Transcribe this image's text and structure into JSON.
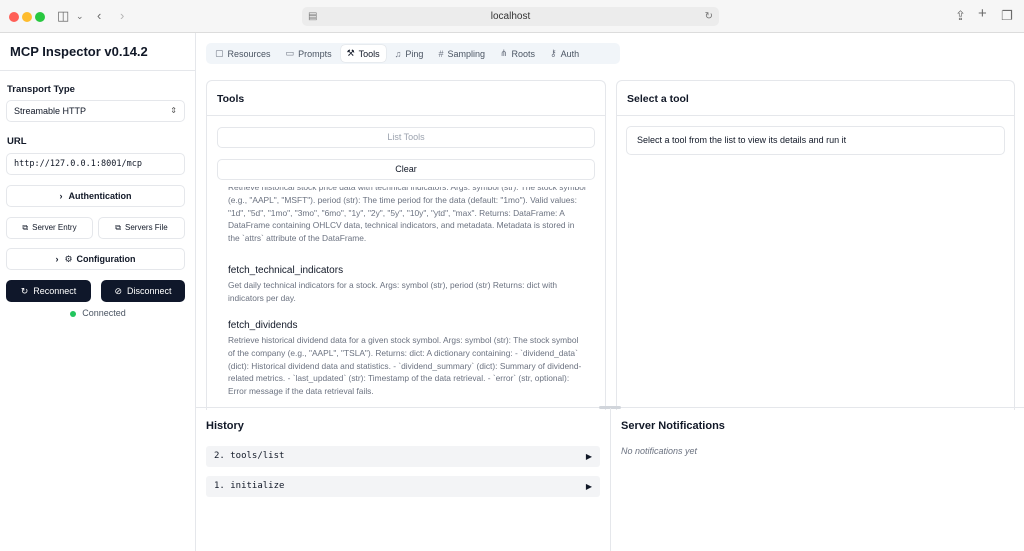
{
  "browser": {
    "url": "localhost"
  },
  "sidebar": {
    "title": "MCP Inspector v0.14.2",
    "transport_label": "Transport Type",
    "transport_value": "Streamable HTTP",
    "url_label": "URL",
    "url_value": "http://127.0.0.1:8001/mcp",
    "authentication_label": "Authentication",
    "server_entry_label": "Server Entry",
    "servers_file_label": "Servers File",
    "configuration_label": "Configuration",
    "reconnect_label": "Reconnect",
    "disconnect_label": "Disconnect",
    "status_text": "Connected",
    "status_color": "#22c55e"
  },
  "tabs": [
    {
      "label": "Resources",
      "icon": "resources-icon",
      "active": false
    },
    {
      "label": "Prompts",
      "icon": "prompts-icon",
      "active": false
    },
    {
      "label": "Tools",
      "icon": "hammer-icon",
      "active": true
    },
    {
      "label": "Ping",
      "icon": "bell-icon",
      "active": false
    },
    {
      "label": "Sampling",
      "icon": "hash-icon",
      "active": false
    },
    {
      "label": "Roots",
      "icon": "network-icon",
      "active": false
    },
    {
      "label": "Auth",
      "icon": "key-icon",
      "active": false
    }
  ],
  "tools_panel": {
    "title": "Tools",
    "list_tools_label": "List Tools",
    "clear_label": "Clear",
    "items": [
      {
        "name": "",
        "description": "Retrieve historical stock price data with technical indicators. Args: symbol (str): The stock symbol (e.g., \"AAPL\", \"MSFT\"). period (str): The time period for the data (default: \"1mo\"). Valid values: \"1d\", \"5d\", \"1mo\", \"3mo\", \"6mo\", \"1y\", \"2y\", \"5y\", \"10y\", \"ytd\", \"max\". Returns: DataFrame: A DataFrame containing OHLCV data, technical indicators, and metadata. Metadata is stored in the `attrs` attribute of the DataFrame."
      },
      {
        "name": "fetch_technical_indicators",
        "description": "Get daily technical indicators for a stock. Args: symbol (str), period (str) Returns: dict with indicators per day."
      },
      {
        "name": "fetch_dividends",
        "description": "Retrieve historical dividend data for a given stock symbol. Args: symbol (str): The stock symbol of the company (e.g., \"AAPL\", \"TSLA\"). Returns: dict: A dictionary containing: - `dividend_data` (dict): Historical dividend data and statistics. - `dividend_summary` (dict): Summary of dividend-related metrics. - `last_updated` (str): Timestamp of the data retrieval. - `error` (str, optional): Error message if the data retrieval fails."
      }
    ]
  },
  "select_panel": {
    "title": "Select a tool",
    "message": "Select a tool from the list to view its details and run it"
  },
  "history": {
    "title": "History",
    "items": [
      {
        "label": "2. tools/list"
      },
      {
        "label": "1. initialize"
      }
    ]
  },
  "notifications": {
    "title": "Server Notifications",
    "empty_text": "No notifications yet"
  }
}
